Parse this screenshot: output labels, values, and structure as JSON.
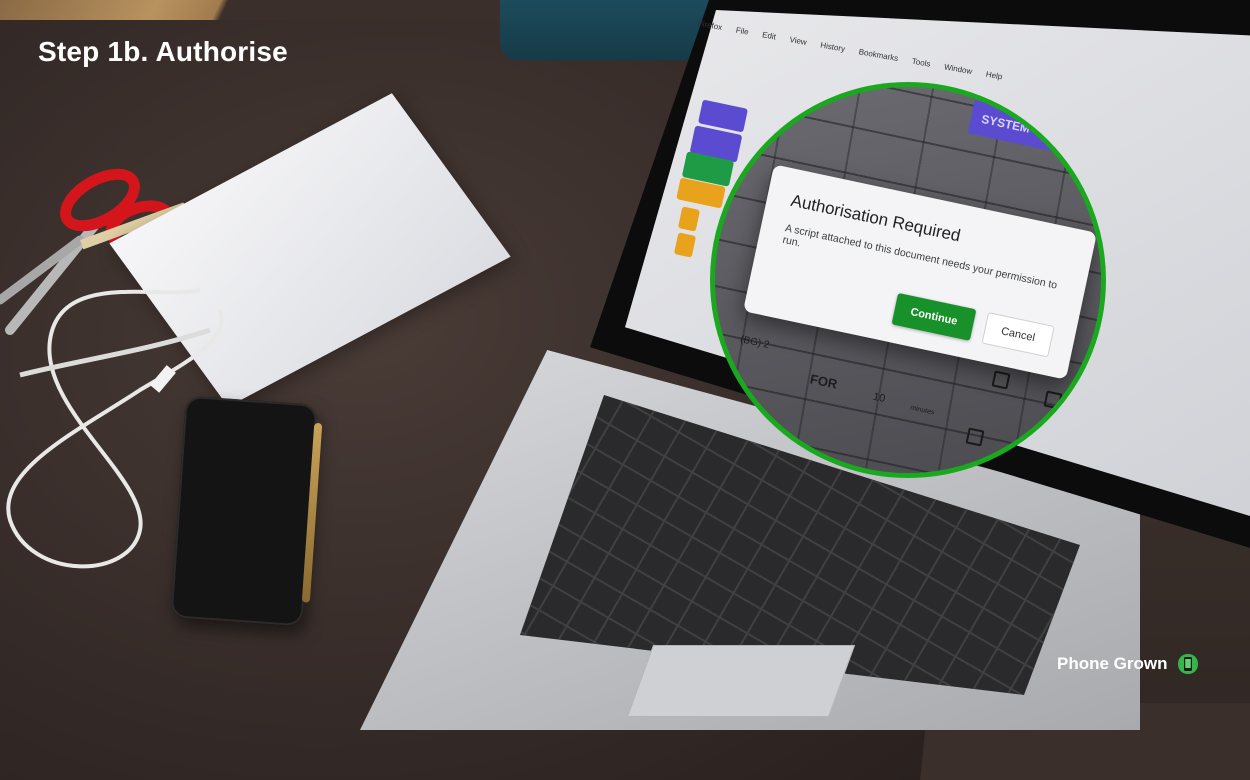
{
  "slide": {
    "title": "Step 1b. Authorise"
  },
  "screen": {
    "menu_items": [
      "Firefox",
      "File",
      "Edit",
      "View",
      "History",
      "Bookmarks",
      "Tools",
      "Window",
      "Help"
    ]
  },
  "zoom": {
    "system_status_label": "SYSTEM STATUS",
    "cells": {
      "bg": "(BG) 2",
      "for": "FOR",
      "ten": "10",
      "minutes": "minutes"
    },
    "dialog": {
      "title": "Authorisation Required",
      "message": "A script attached to this document needs your permission to run.",
      "continue_label": "Continue",
      "cancel_label": "Cancel"
    },
    "highlight_color": "#19a81e",
    "continue_color": "#18912a"
  },
  "brand": {
    "name": "Phone Grown",
    "logo_icon": "green-phone-logo-icon"
  }
}
